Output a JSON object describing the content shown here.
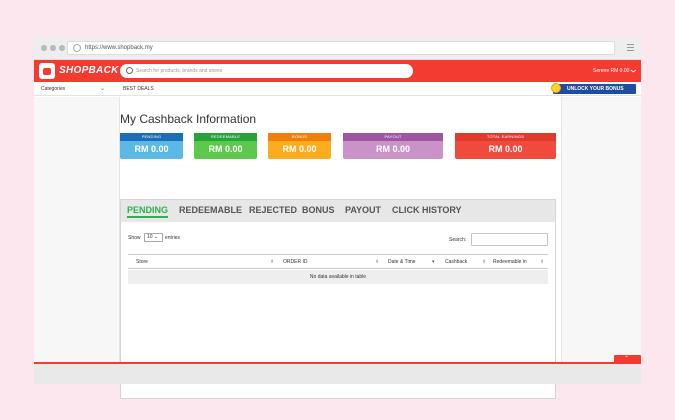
{
  "browser": {
    "url": "https://www.shopback.my"
  },
  "header": {
    "logo": "SHOPBACK",
    "search_placeholder": "Search for products, brands and stores",
    "user": "Serene RM 0.00",
    "user_chevron": "❯"
  },
  "nav": {
    "categories": "Categories",
    "categories_chevron": "⌄",
    "best_deals": "BEST DEALS",
    "unlock": "UNLOCK YOUR BONUS"
  },
  "page": {
    "title": "My Cashback Information"
  },
  "cards": [
    {
      "label": "PENDING",
      "value": "RM 0.00",
      "top": "#1c6eb6",
      "body": "#5cb9e5"
    },
    {
      "label": "REDEEMABLE",
      "value": "RM 0.00",
      "top": "#27a33c",
      "body": "#5dc94c"
    },
    {
      "label": "BONUS",
      "value": "RM 0.00",
      "top": "#ef7e0a",
      "body": "#fbad1e"
    },
    {
      "label": "PAYOUT",
      "value": "RM 0.00",
      "top": "#9c57a0",
      "body": "#c993c7"
    },
    {
      "label": "TOTAL EARNINGS",
      "value": "RM 0.00",
      "top": "#e03a2f",
      "body": "#ef4a3c"
    }
  ],
  "tabs": [
    "PENDING",
    "REDEEMABLE",
    "REJECTED",
    "BONUS",
    "PAYOUT",
    "CLICK HISTORY"
  ],
  "table": {
    "show": "Show",
    "length": "10",
    "length_chevron": "⌄",
    "entries": "entries",
    "search_label": "Search:",
    "columns": [
      "Store",
      "ORDER ID",
      "Date & Time",
      "Cashback",
      "Redeemable in"
    ],
    "sort_glyph": "⬍",
    "sort_active_glyph": "▾",
    "empty": "No data available in table"
  },
  "footer": {
    "to_top": "⌃"
  }
}
